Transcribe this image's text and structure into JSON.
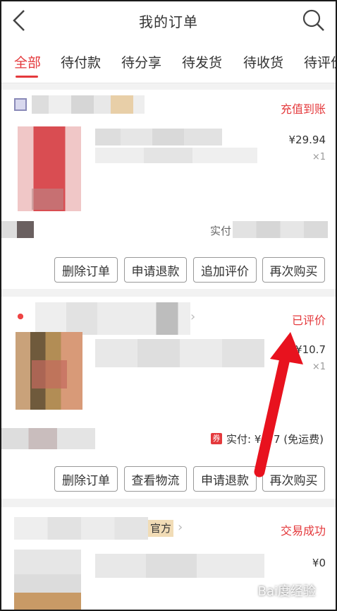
{
  "header": {
    "title": "我的订单",
    "back_icon": "back-chevron-icon",
    "search_icon": "search-icon"
  },
  "tabs": [
    {
      "label": "全部",
      "active": true
    },
    {
      "label": "待付款",
      "active": false
    },
    {
      "label": "待分享",
      "active": false
    },
    {
      "label": "待发货",
      "active": false
    },
    {
      "label": "待收货",
      "active": false
    },
    {
      "label": "待评价",
      "active": false
    }
  ],
  "orders": [
    {
      "status": "充值到账",
      "price": "¥29.94",
      "quantity": "×1",
      "paid_label": "实付",
      "buttons": [
        "删除订单",
        "申请退款",
        "追加评价",
        "再次购买"
      ]
    },
    {
      "status": "已评价",
      "price": "¥10.7",
      "quantity": "×1",
      "coupon_badge": "券",
      "paid_label": "实付: ¥",
      "paid_amount": "7 (免运费)",
      "buttons": [
        "删除订单",
        "查看物流",
        "申请退款",
        "再次购买"
      ]
    },
    {
      "store_tag": "官方",
      "status": "交易成功",
      "price": "¥0"
    }
  ],
  "watermark": "Bai度经验",
  "colors": {
    "accent": "#e4393c",
    "arrow": "#e8121e"
  }
}
